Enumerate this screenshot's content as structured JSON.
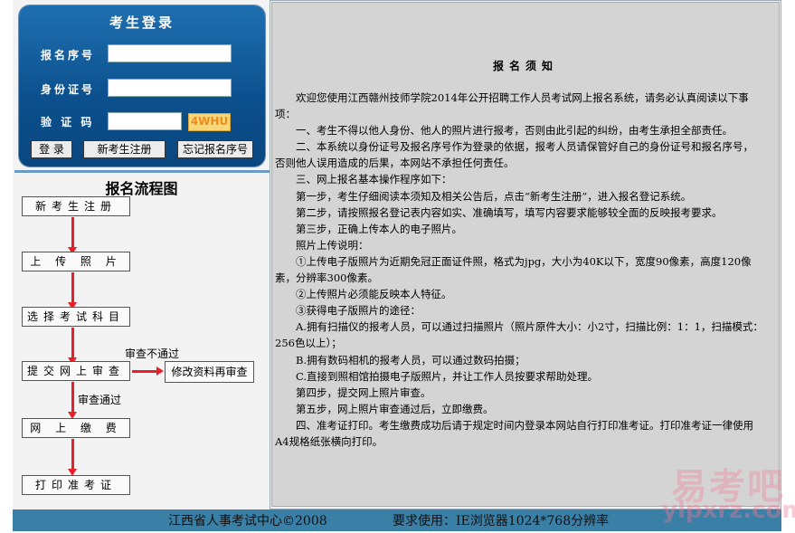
{
  "login": {
    "title": "考生登录",
    "reg_label": "报名序号",
    "id_label": "身份证号",
    "captcha_label": "验 证 码",
    "captcha_code": "4WHU",
    "login_btn": "登  录",
    "register_btn": "新考生注册",
    "forgot_btn": "忘记报名序号"
  },
  "flow": {
    "title": "报名流程图",
    "steps": [
      "新考生注册",
      "上 传 照 片",
      "选择考试科目",
      "提交网上审查",
      "网 上 缴 费",
      "打印准考证"
    ],
    "fail_label": "审查不通过",
    "pass_label": "审查通过",
    "fix_label": "修改资料再审查"
  },
  "notice": {
    "title": "报名须知",
    "paragraphs": [
      "欢迎您使用江西赣州技师学院2014年公开招聘工作人员考试网上报名系统，请务必认真阅读以下事项：",
      "一、考生不得以他人身份、他人的照片进行报考，否则由此引起的纠纷，由考生承担全部责任。",
      "二、本系统以身份证号及报名序号作为登录的依据，报考人员请保管好自己的身份证号和报名序号，否则他人误用造成的后果，本网站不承担任何责任。",
      "三、网上报名基本操作程序如下：",
      "第一步，考生仔细阅读本须知及相关公告后，点击“新考生注册”，进入报名登记系统。",
      "第二步，请按照报名登记表内容如实、准确填写，填写内容要求能够较全面的反映报考要求。",
      "第三步，正确上传本人的电子照片。",
      "照片上传说明：",
      "①上传电子版照片为近期免冠正面证件照，格式为jpg，大小为40K以下，宽度90像素，高度120像素，分辨率300像素。",
      "②上传照片必须能反映本人特征。",
      "③获得电子版照片的途径：",
      "A.拥有扫描仪的报考人员，可以通过扫描照片（照片原件大小：小2寸，扫描比例：1：1，扫描模式：256色以上）；",
      "B.拥有数码相机的报考人员，可以通过数码拍摄；",
      "C.直接到照相馆拍摄电子版照片，并让工作人员按要求帮助处理。",
      "第四步，提交网上照片审查。",
      "第五步，网上照片审查通过后，立即缴费。",
      "四、准考证打印。考生缴费成功后请于规定时间内登录本网站自行打印准考证。打印准考证一律使用A4规格纸张横向打印。"
    ]
  },
  "footer": {
    "copyright": "江西省人事考试中心©2008",
    "requirement": "要求使用：IE浏览器1024*768分辨率"
  },
  "watermark": {
    "chars": "易考吧",
    "url": "ylpxrz.com"
  }
}
